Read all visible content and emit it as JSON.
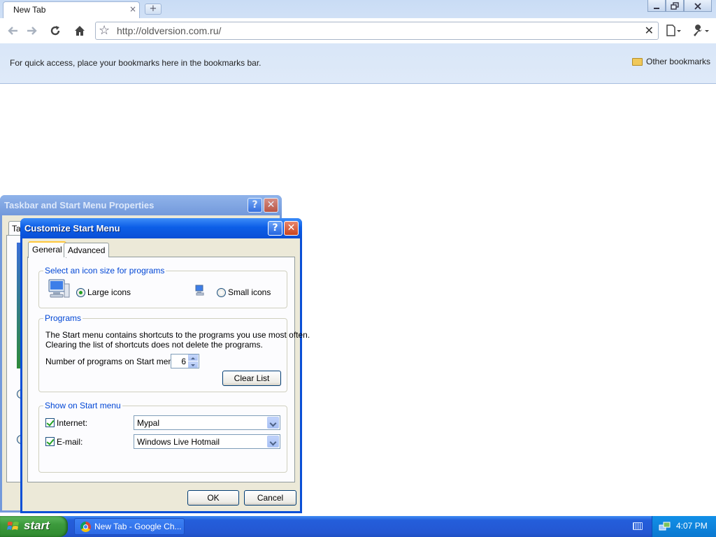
{
  "browser": {
    "tab_title": "New Tab",
    "tab_close": "×",
    "new_tab": "+",
    "url": "http://oldversion.com.ru/",
    "bookmarks_hint": "For quick access, place your bookmarks here in the bookmarks bar.",
    "other_bookmarks": "Other bookmarks",
    "clear_omnibox": "✕"
  },
  "back_dialog": {
    "title": "Taskbar and Start Menu Properties",
    "help": "?",
    "close": "✕",
    "tab_partial": "Ta"
  },
  "dialog": {
    "title": "Customize Start Menu",
    "help": "?",
    "close": "✕",
    "tabs": [
      {
        "label": "General",
        "active": true
      },
      {
        "label": "Advanced",
        "active": false
      }
    ],
    "icon_size": {
      "legend": "Select an icon size for programs",
      "large_label": "Large icons",
      "small_label": "Small icons",
      "selected": "large"
    },
    "programs": {
      "legend": "Programs",
      "description_line1": "The Start menu contains shortcuts to the programs you use most often.",
      "description_line2": "Clearing the list of shortcuts does not delete the programs.",
      "count_label": "Number of programs on Start menu:",
      "count_value": "6",
      "clear_button": "Clear List"
    },
    "show": {
      "legend": "Show on Start menu",
      "internet_label": "Internet:",
      "internet_checked": true,
      "internet_value": "Mypal",
      "email_label": "E-mail:",
      "email_checked": true,
      "email_value": "Windows Live Hotmail"
    },
    "ok": "OK",
    "cancel": "Cancel"
  },
  "taskbar": {
    "start": "start",
    "task_label": "New Tab - Google Ch...",
    "clock": "4:07 PM"
  },
  "colors": {
    "xp_title_blue": "#0a4fd6",
    "taskbar_blue": "#245edb",
    "start_green": "#3c9a3c",
    "group_label_blue": "#0046d5"
  }
}
